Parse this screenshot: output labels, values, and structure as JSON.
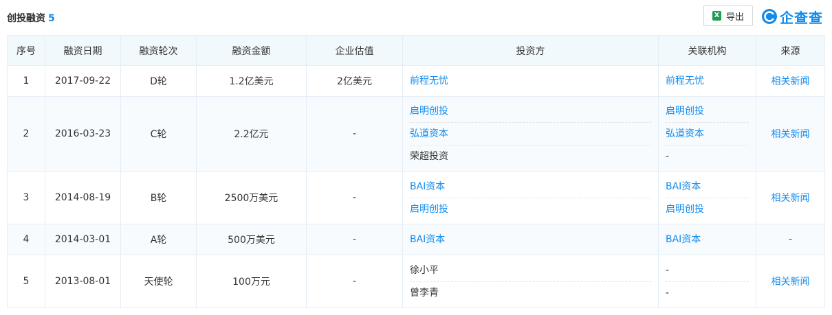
{
  "header": {
    "title": "创投融资",
    "count": "5",
    "export_label": "导出",
    "brand_name": "企查查"
  },
  "colors": {
    "accent": "#128bed",
    "excel": "#1d9e54",
    "header_bg": "#f2f9fc"
  },
  "icons": {
    "export": "excel-icon",
    "brand": "qcc-logo-icon"
  },
  "table": {
    "columns": [
      "序号",
      "融资日期",
      "融资轮次",
      "融资金额",
      "企业估值",
      "投资方",
      "关联机构",
      "来源"
    ],
    "rows": [
      {
        "index": "1",
        "date": "2017-09-22",
        "round": "D轮",
        "amount": "1.2亿美元",
        "valuation": "2亿美元",
        "investors": [
          {
            "name": "前程无忧",
            "link": true,
            "org": "前程无忧",
            "org_link": true
          }
        ],
        "source": "相关新闻",
        "source_link": true
      },
      {
        "index": "2",
        "date": "2016-03-23",
        "round": "C轮",
        "amount": "2.2亿元",
        "valuation": "-",
        "investors": [
          {
            "name": "启明创投",
            "link": true,
            "org": "启明创投",
            "org_link": true
          },
          {
            "name": "弘道资本",
            "link": true,
            "org": "弘道资本",
            "org_link": true
          },
          {
            "name": "荣超投资",
            "link": false,
            "org": "-",
            "org_link": false
          }
        ],
        "source": "相关新闻",
        "source_link": true
      },
      {
        "index": "3",
        "date": "2014-08-19",
        "round": "B轮",
        "amount": "2500万美元",
        "valuation": "-",
        "investors": [
          {
            "name": "BAI资本",
            "link": true,
            "org": "BAI资本",
            "org_link": true
          },
          {
            "name": "启明创投",
            "link": true,
            "org": "启明创投",
            "org_link": true
          }
        ],
        "source": "相关新闻",
        "source_link": true
      },
      {
        "index": "4",
        "date": "2014-03-01",
        "round": "A轮",
        "amount": "500万美元",
        "valuation": "-",
        "investors": [
          {
            "name": "BAI资本",
            "link": true,
            "org": "BAI资本",
            "org_link": true
          }
        ],
        "source": "-",
        "source_link": false
      },
      {
        "index": "5",
        "date": "2013-08-01",
        "round": "天使轮",
        "amount": "100万元",
        "valuation": "-",
        "investors": [
          {
            "name": "徐小平",
            "link": false,
            "org": "-",
            "org_link": false
          },
          {
            "name": "曾李青",
            "link": false,
            "org": "-",
            "org_link": false
          }
        ],
        "source": "相关新闻",
        "source_link": true
      }
    ]
  }
}
